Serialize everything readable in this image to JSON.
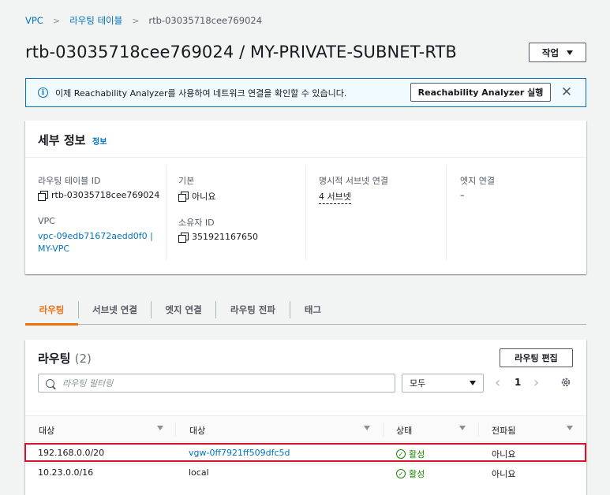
{
  "breadcrumb": {
    "vpc": "VPC",
    "route_tables": "라우팅 테이블",
    "current": "rtb-03035718cee769024"
  },
  "page_title": "rtb-03035718cee769024 / MY-PRIVATE-SUBNET-RTB",
  "actions_label": "작업",
  "banner": {
    "text": "이제 Reachability Analyzer를 사용하여 네트워크 연결을 확인할 수 있습니다.",
    "button": "Reachability Analyzer 실행",
    "info_icon": "i",
    "close_icon": "✕"
  },
  "details": {
    "title": "세부 정보",
    "info_link": "정보",
    "route_table_id_label": "라우팅 테이블 ID",
    "route_table_id": "rtb-03035718cee769024",
    "vpc_label": "VPC",
    "vpc_value_line1": "vpc-09edb71672aedd0f0 |",
    "vpc_value_line2": "MY-VPC",
    "main_label": "기본",
    "main_value": "아니요",
    "owner_label": "소유자 ID",
    "owner_value": "351921167650",
    "explicit_label": "명시적 서브넷 연결",
    "explicit_value": "4 서브넷",
    "edge_label": "엣지 연결",
    "edge_value": "–"
  },
  "tabs": [
    "라우팅",
    "서브넷 연결",
    "엣지 연결",
    "라우팅 전파",
    "태그"
  ],
  "routes": {
    "title": "라우팅",
    "count": "(2)",
    "edit_button": "라우팅 편집",
    "filter_placeholder": "라우팅 필터링",
    "select_value": "모두",
    "page": "1",
    "prev_icon": "‹",
    "next_icon": "›",
    "columns": [
      "대상",
      "대상",
      "상태",
      "전파됨"
    ],
    "rows": [
      {
        "destination": "192.168.0.0/20",
        "target": "vgw-0ff7921ff509dfc5d",
        "status": "활성",
        "propagated": "아니요"
      },
      {
        "destination": "10.23.0.0/16",
        "target": "local",
        "status": "활성",
        "propagated": "아니요"
      }
    ],
    "status_icon": "✓"
  },
  "colors": {
    "accent": "#ec7211",
    "link": "#0073bb",
    "success": "#1d8102",
    "highlight": "#d9122a"
  }
}
